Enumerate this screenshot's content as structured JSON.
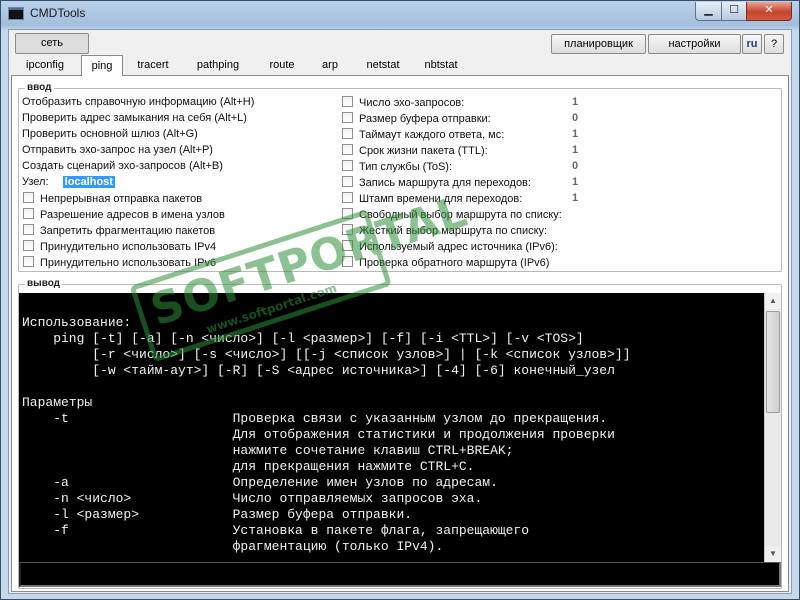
{
  "window": {
    "title": "CMDTools",
    "minimize": "▁",
    "maximize": "☐",
    "close": "✕"
  },
  "toolbar": {
    "net": "сеть",
    "scheduler": "планировщик",
    "settings": "настройки",
    "lang": "ru",
    "help": "?"
  },
  "tabs": [
    "ipconfig",
    "ping",
    "tracert",
    "pathping",
    "route",
    "arp",
    "netstat",
    "nbtstat"
  ],
  "active_tab": "ping",
  "input_group": {
    "title": "ввод",
    "actions": [
      "Отобразить справочную информацию (Alt+H)",
      "Проверить адрес замыкания на себя (Alt+L)",
      "Проверить основной шлюз (Alt+G)",
      "Отправить эхо-запрос на узел (Alt+P)",
      "Создать сценарий эхо-запросов (Alt+B)"
    ],
    "host_label": "Узел:",
    "host_value": "localhost",
    "left_checks": [
      "Непрерывная отправка пакетов",
      "Разрешение адресов в имена узлов",
      "Запретить фрагментацию пакетов",
      "Принудительно использовать IPv4",
      "Принудительно использовать IPv6"
    ],
    "right_params": [
      {
        "label": "Число эхо-запросов:",
        "value": "1"
      },
      {
        "label": "Размер буфера отправки:",
        "value": "0"
      },
      {
        "label": "Таймаут каждого ответа, мс:",
        "value": "1"
      },
      {
        "label": "Срок жизни пакета (TTL):",
        "value": "1"
      },
      {
        "label": "Тип службы (ToS):",
        "value": "0"
      },
      {
        "label": "Запись маршрута для переходов:",
        "value": "1"
      },
      {
        "label": "Штамп времени для переходов:",
        "value": "1"
      },
      {
        "label": "Свободный выбор маршрута по списку:",
        "value": ""
      },
      {
        "label": "Жесткий выбор маршрута по списку:",
        "value": ""
      },
      {
        "label": "Используемый адрес источника (IPv6):",
        "value": ""
      },
      {
        "label": "Проверка обратного маршрута (IPv6)",
        "value": ""
      }
    ]
  },
  "output_group": {
    "title": "вывод",
    "lines": [
      "",
      "Использование:",
      "    ping [-t] [-a] [-n <число>] [-l <размер>] [-f] [-i <TTL>] [-v <TOS>]",
      "         [-r <число>] [-s <число>] [[-j <список узлов>] | [-k <список узлов>]]",
      "         [-w <тайм-аут>] [-R] [-S <адрес источника>] [-4] [-6] конечный_узел",
      "",
      "Параметры",
      "    -t                     Проверка связи с указанным узлом до прекращения.",
      "                           Для отображения статистики и продолжения проверки",
      "                           нажмите сочетание клавиш CTRL+BREAK;",
      "                           для прекращения нажмите CTRL+C.",
      "    -a                     Определение имен узлов по адресам.",
      "    -n <число>             Число отправляемых запросов эха.",
      "    -l <размер>            Размер буфера отправки.",
      "    -f                     Установка в пакете флага, запрещающего",
      "                           фрагментацию (только IPv4)."
    ]
  },
  "watermark": {
    "text": "SOFTPORTAL",
    "url": "www.softportal.com"
  }
}
